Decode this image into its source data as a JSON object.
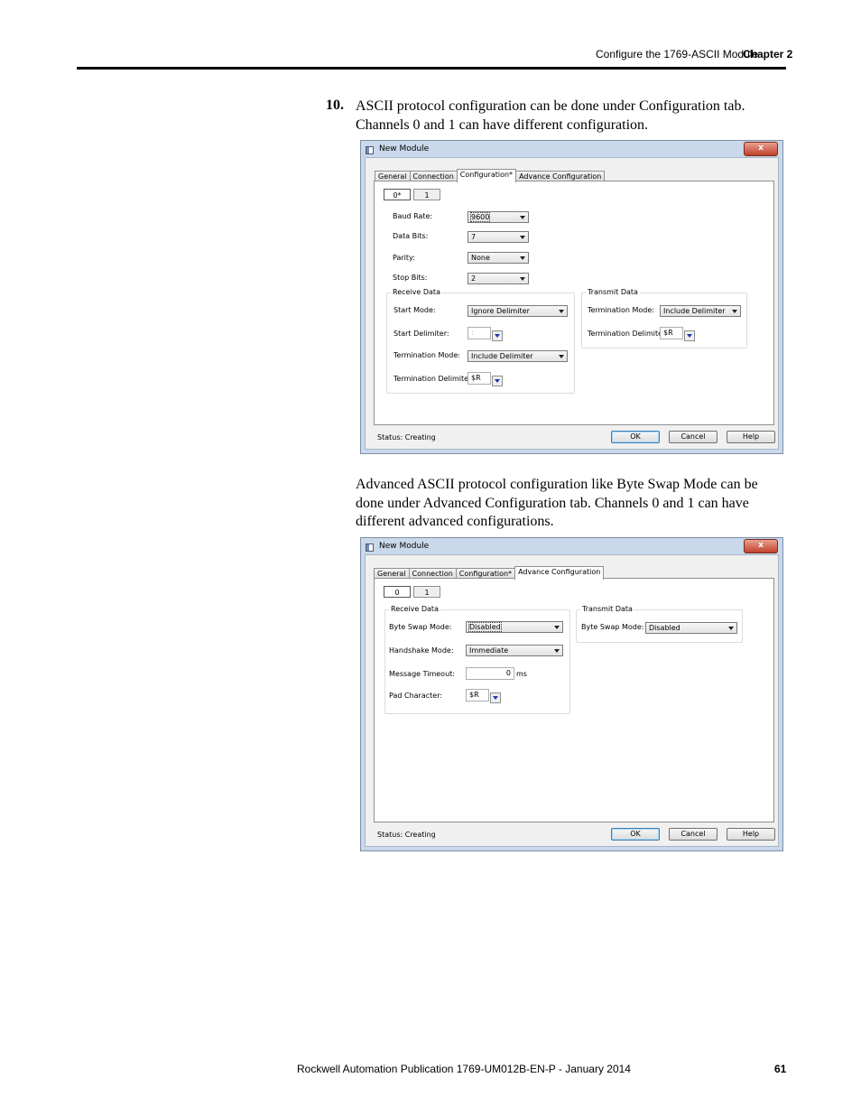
{
  "header": {
    "section": "Configure the 1769-ASCII Module",
    "chapter": "Chapter 2"
  },
  "step": {
    "number": "10.",
    "lines": [
      "ASCII protocol configuration can be done under Configuration tab.",
      "Channels 0 and 1 can have different configuration."
    ]
  },
  "paragraph2": {
    "lines": [
      "Advanced ASCII protocol configuration like Byte Swap Mode can be",
      "done under Advanced Configuration tab. Channels 0 and 1 can have",
      "different advanced configurations."
    ]
  },
  "dialog1": {
    "title": "New Module",
    "close": "x",
    "tabs": [
      "General",
      "Connection",
      "Configuration*",
      "Advance Configuration"
    ],
    "active_tab": "Configuration*",
    "channels": [
      "0*",
      "1"
    ],
    "fields": {
      "baud_rate": {
        "label": "Baud Rate:",
        "value": "9600"
      },
      "data_bits": {
        "label": "Data Bits:",
        "value": "7"
      },
      "parity": {
        "label": "Parity:",
        "value": "None"
      },
      "stop_bits": {
        "label": "Stop Bits:",
        "value": "2"
      }
    },
    "receive": {
      "title": "Receive Data",
      "start_mode": {
        "label": "Start Mode:",
        "value": "Ignore Delimiter"
      },
      "start_delimiter": {
        "label": "Start Delimiter:",
        "value": ":"
      },
      "termination_mode": {
        "label": "Termination Mode:",
        "value": "Include Delimiter"
      },
      "termination_delimiter": {
        "label": "Termination Delimiter:",
        "value": "$R"
      }
    },
    "transmit": {
      "title": "Transmit Data",
      "termination_mode": {
        "label": "Termination Mode:",
        "value": "Include Delimiter"
      },
      "termination_delimiter": {
        "label": "Termination Delimiter:",
        "value": "$R"
      }
    },
    "status": "Status:  Creating",
    "buttons": {
      "ok": "OK",
      "cancel": "Cancel",
      "help": "Help"
    }
  },
  "dialog2": {
    "title": "New Module",
    "close": "x",
    "tabs": [
      "General",
      "Connection",
      "Configuration*",
      "Advance Configuration"
    ],
    "active_tab": "Advance Configuration",
    "channels": [
      "0",
      "1"
    ],
    "receive": {
      "title": "Receive Data",
      "byte_swap_mode": {
        "label": "Byte Swap Mode:",
        "value": "Disabled"
      },
      "handshake_mode": {
        "label": "Handshake Mode:",
        "value": "Immediate"
      },
      "message_timeout": {
        "label": "Message Timeout:",
        "value": "0",
        "unit": "ms"
      },
      "pad_character": {
        "label": "Pad Character:",
        "value": "$R"
      }
    },
    "transmit": {
      "title": "Transmit Data",
      "byte_swap_mode": {
        "label": "Byte Swap Mode:",
        "value": "Disabled"
      }
    },
    "status": "Status:  Creating",
    "buttons": {
      "ok": "OK",
      "cancel": "Cancel",
      "help": "Help"
    }
  },
  "footer": {
    "publication": "Rockwell Automation Publication 1769-UM012B-EN-P - January 2014",
    "page_number": "61"
  }
}
